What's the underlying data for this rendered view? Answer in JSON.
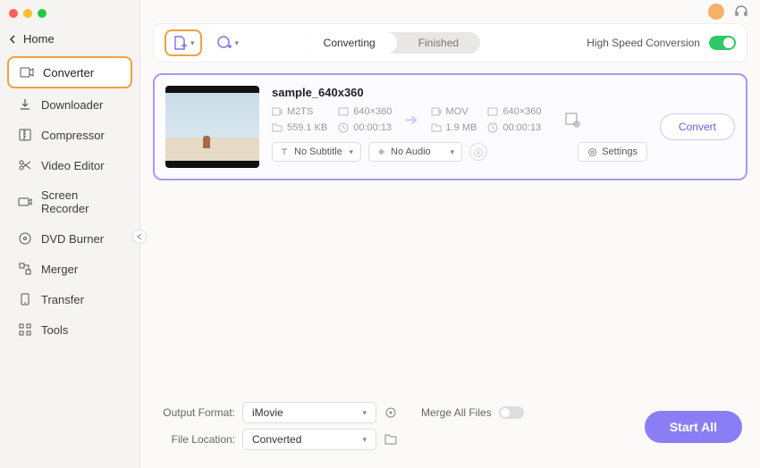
{
  "sidebar": {
    "home_label": "Home",
    "items": [
      {
        "label": "Converter",
        "icon": "converter-icon"
      },
      {
        "label": "Downloader",
        "icon": "downloader-icon"
      },
      {
        "label": "Compressor",
        "icon": "compressor-icon"
      },
      {
        "label": "Video Editor",
        "icon": "scissors-icon"
      },
      {
        "label": "Screen Recorder",
        "icon": "camera-icon"
      },
      {
        "label": "DVD Burner",
        "icon": "disc-icon"
      },
      {
        "label": "Merger",
        "icon": "merge-icon"
      },
      {
        "label": "Transfer",
        "icon": "transfer-icon"
      },
      {
        "label": "Tools",
        "icon": "grid-icon"
      }
    ]
  },
  "toolbar": {
    "tabs": {
      "converting": "Converting",
      "finished": "Finished"
    },
    "high_speed_label": "High Speed Conversion"
  },
  "file": {
    "name": "sample_640x360",
    "src": {
      "format": "M2TS",
      "resolution": "640×360",
      "size": "559.1 KB",
      "duration": "00:00:13"
    },
    "dst": {
      "format": "MOV",
      "resolution": "640×360",
      "size": "1.9 MB",
      "duration": "00:00:13"
    },
    "subtitle_label": "No Subtitle",
    "audio_label": "No Audio",
    "settings_label": "Settings",
    "convert_label": "Convert"
  },
  "footer": {
    "output_format_label": "Output Format:",
    "output_format_value": "iMovie",
    "file_location_label": "File Location:",
    "file_location_value": "Converted",
    "merge_label": "Merge All Files",
    "start_all_label": "Start All"
  }
}
